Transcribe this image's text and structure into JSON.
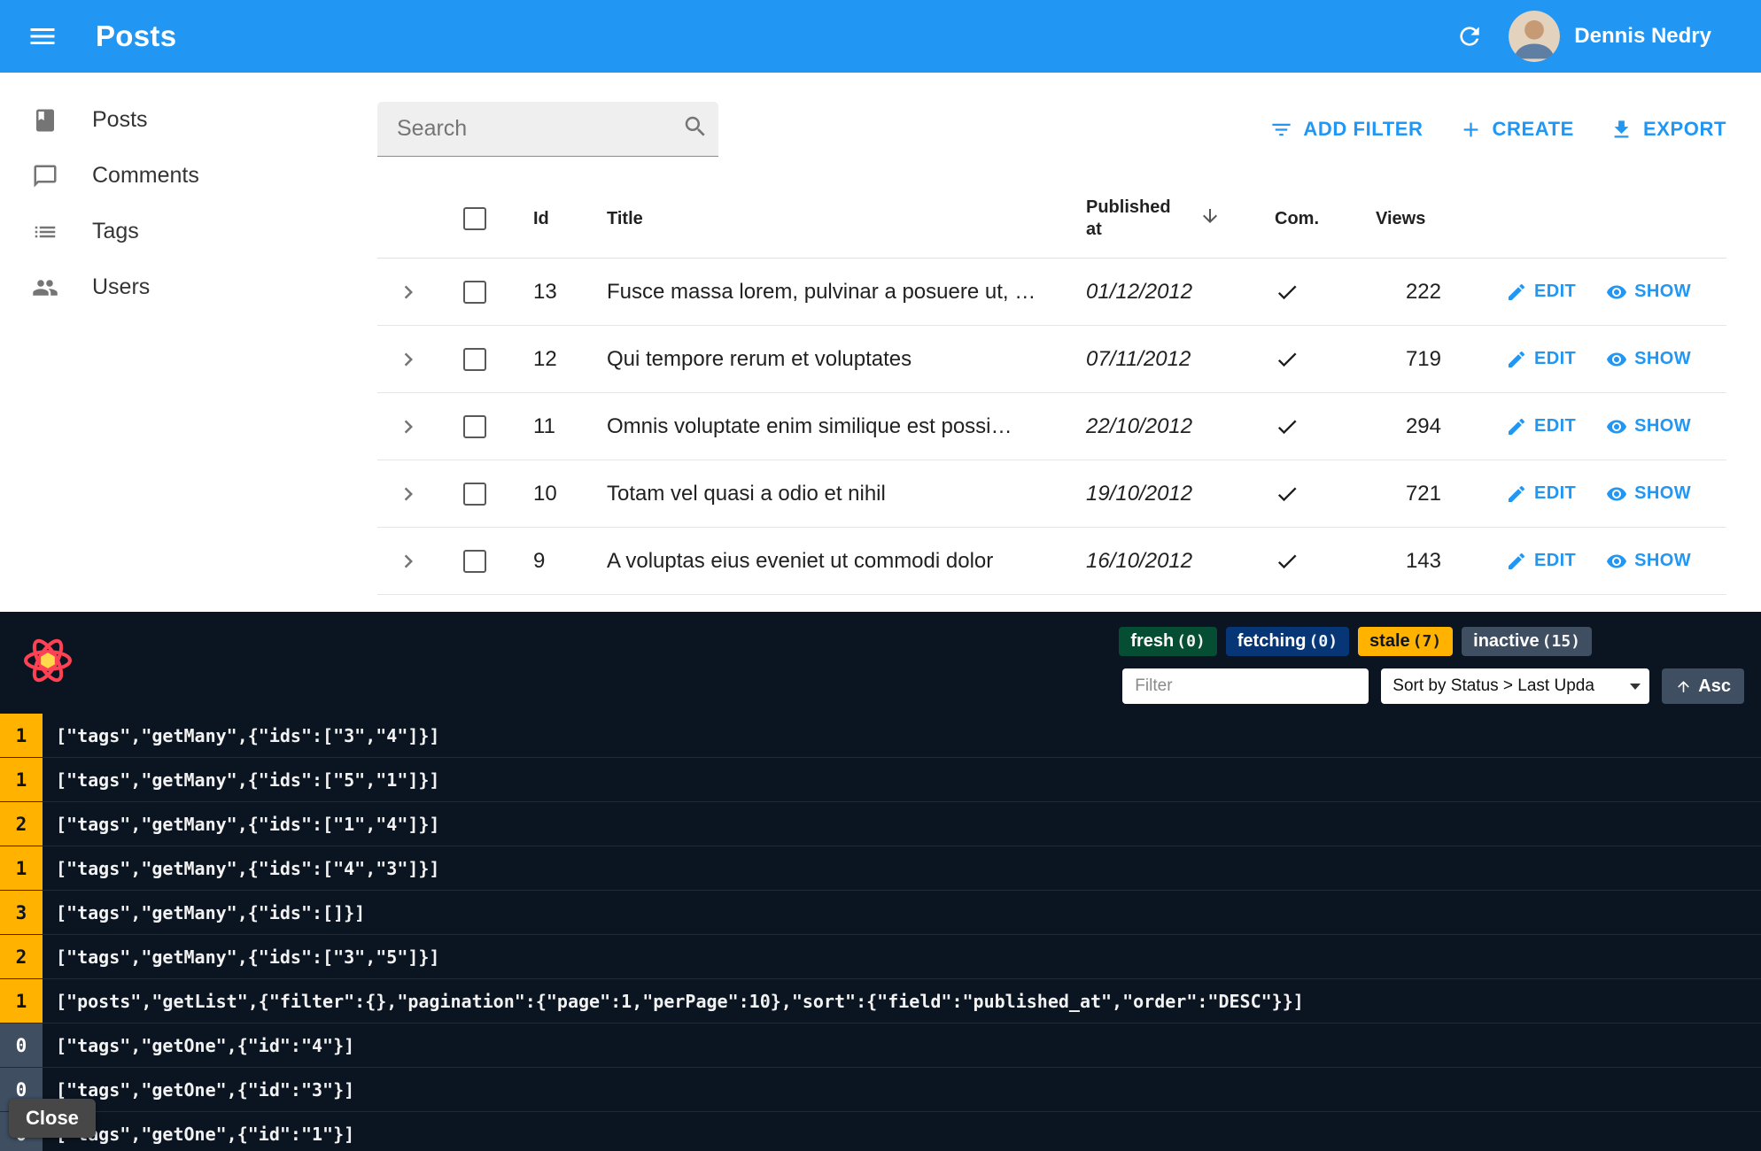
{
  "app_bar": {
    "title": "Posts",
    "user_name": "Dennis Nedry"
  },
  "sidebar": {
    "items": [
      {
        "label": "Posts"
      },
      {
        "label": "Comments"
      },
      {
        "label": "Tags"
      },
      {
        "label": "Users"
      }
    ]
  },
  "toolbar": {
    "search_placeholder": "Search",
    "buttons": {
      "add_filter": "ADD FILTER",
      "create": "CREATE",
      "export": "EXPORT"
    }
  },
  "table": {
    "headers": {
      "id": "Id",
      "title": "Title",
      "published_at": "Published at",
      "commentable": "Com.",
      "views": "Views"
    },
    "actions": {
      "edit": "EDIT",
      "show": "SHOW"
    },
    "rows": [
      {
        "id": "13",
        "title": "Fusce massa lorem, pulvinar a posuere ut, …",
        "published_at": "01/12/2012",
        "views": "222"
      },
      {
        "id": "12",
        "title": "Qui tempore rerum et voluptates",
        "published_at": "07/11/2012",
        "views": "719"
      },
      {
        "id": "11",
        "title": "Omnis voluptate enim similique est possi…",
        "published_at": "22/10/2012",
        "views": "294"
      },
      {
        "id": "10",
        "title": "Totam vel quasi a odio et nihil",
        "published_at": "19/10/2012",
        "views": "721"
      },
      {
        "id": "9",
        "title": "A voluptas eius eveniet ut commodi dolor",
        "published_at": "16/10/2012",
        "views": "143"
      }
    ]
  },
  "devtools": {
    "status_badges": [
      {
        "label": "fresh",
        "count": "(0)",
        "state": "fresh"
      },
      {
        "label": "fetching",
        "count": "(0)",
        "state": "fetching"
      },
      {
        "label": "stale",
        "count": "(7)",
        "state": "stale"
      },
      {
        "label": "inactive",
        "count": "(15)",
        "state": "inactive"
      }
    ],
    "filter_placeholder": "Filter",
    "sort_value": "Sort by Status > Last Upda",
    "sort_direction": "Asc",
    "close_label": "Close",
    "queries": [
      {
        "observers": "1",
        "state": "stale",
        "key": "[\"tags\",\"getMany\",{\"ids\":[\"3\",\"4\"]}]"
      },
      {
        "observers": "1",
        "state": "stale",
        "key": "[\"tags\",\"getMany\",{\"ids\":[\"5\",\"1\"]}]"
      },
      {
        "observers": "2",
        "state": "stale",
        "key": "[\"tags\",\"getMany\",{\"ids\":[\"1\",\"4\"]}]"
      },
      {
        "observers": "1",
        "state": "stale",
        "key": "[\"tags\",\"getMany\",{\"ids\":[\"4\",\"3\"]}]"
      },
      {
        "observers": "3",
        "state": "stale",
        "key": "[\"tags\",\"getMany\",{\"ids\":[]}]"
      },
      {
        "observers": "2",
        "state": "stale",
        "key": "[\"tags\",\"getMany\",{\"ids\":[\"3\",\"5\"]}]"
      },
      {
        "observers": "1",
        "state": "stale",
        "key": "[\"posts\",\"getList\",{\"filter\":{},\"pagination\":{\"page\":1,\"perPage\":10},\"sort\":{\"field\":\"published_at\",\"order\":\"DESC\"}}]"
      },
      {
        "observers": "0",
        "state": "inactive",
        "key": "[\"tags\",\"getOne\",{\"id\":\"4\"}]"
      },
      {
        "observers": "0",
        "state": "inactive",
        "key": "[\"tags\",\"getOne\",{\"id\":\"3\"}]"
      },
      {
        "observers": "0",
        "state": "inactive",
        "key": "[\"tags\",\"getOne\",{\"id\":\"1\"}]"
      }
    ],
    "colors": {
      "accent": "#2196f3",
      "devtools_bg": "#0b1521",
      "fresh": "#00ab52",
      "fetching": "#006bff",
      "stale": "#ffb200",
      "inactive": "#3f4e60"
    }
  }
}
